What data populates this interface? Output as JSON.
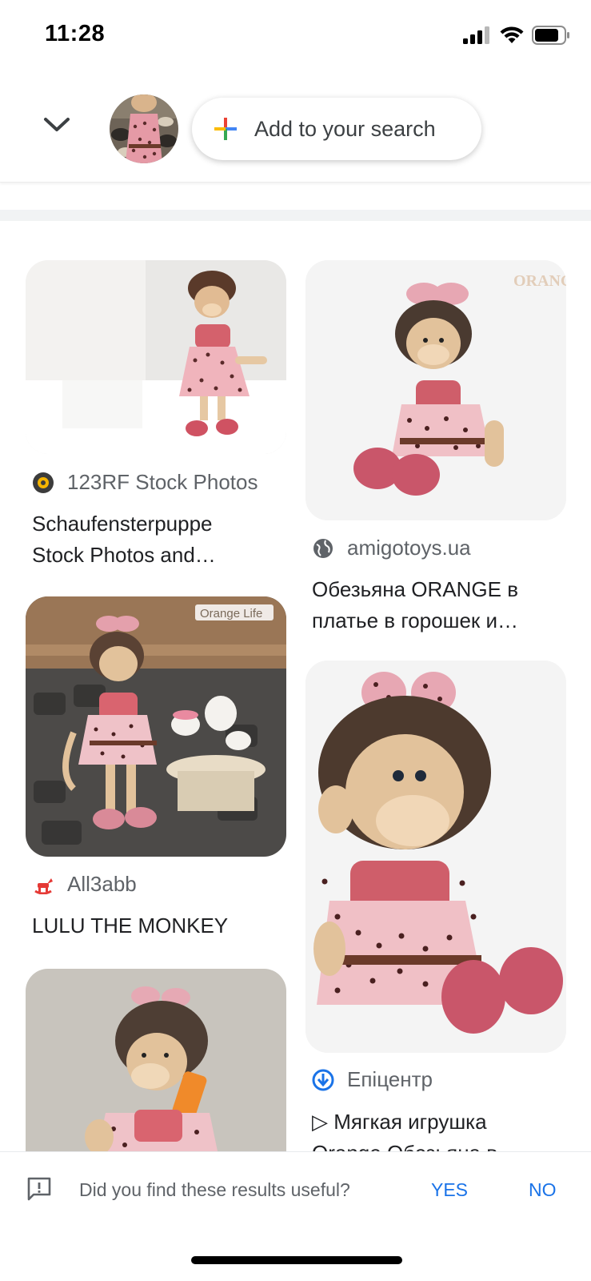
{
  "status_bar": {
    "time": "11:28"
  },
  "search_bar": {
    "add_label": "Add to your search"
  },
  "results": [
    {
      "source": "123RF Stock Photos",
      "title": "Schaufensterpuppe\nStock Photos and…"
    },
    {
      "source": "amigotoys.ua",
      "title": "Обезьяна ORANGE в\nплатье в горошек и…"
    },
    {
      "source": "All3abb",
      "title": "LULU THE MONKEY"
    },
    {
      "source": "Епіцентр",
      "title": "▷ Мягкая игрушка\nOrange Обезьяна в"
    }
  ],
  "feedback": {
    "question": "Did you find these results useful?",
    "yes_label": "YES",
    "no_label": "NO"
  },
  "colors": {
    "accent": "#1a73e8",
    "text": "#202124",
    "secondary_text": "#5f6368"
  }
}
